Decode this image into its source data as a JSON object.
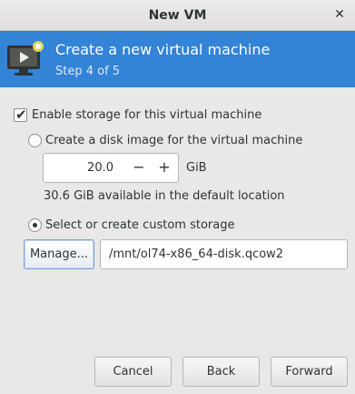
{
  "window": {
    "title": "New VM",
    "close_glyph": "✕"
  },
  "banner": {
    "icon": "virtual-machine-monitor-icon",
    "heading": "Create a new virtual machine",
    "step": "Step 4 of 5",
    "color": "#3383d6"
  },
  "storage": {
    "enable_label": "Enable storage for this virtual machine",
    "enable_checked": true,
    "create_disk_label": "Create a disk image for the virtual machine",
    "create_disk_selected": false,
    "size_value": "20.0",
    "size_unit": "GiB",
    "minus_label": "−",
    "plus_label": "+",
    "available_text": "30.6 GiB available in the default location",
    "custom_label": "Select or create custom storage",
    "custom_selected": true,
    "manage_label": "Manage...",
    "custom_path": "/mnt/ol74-x86_64-disk.qcow2"
  },
  "buttons": {
    "cancel": "Cancel",
    "back": "Back",
    "forward": "Forward"
  }
}
